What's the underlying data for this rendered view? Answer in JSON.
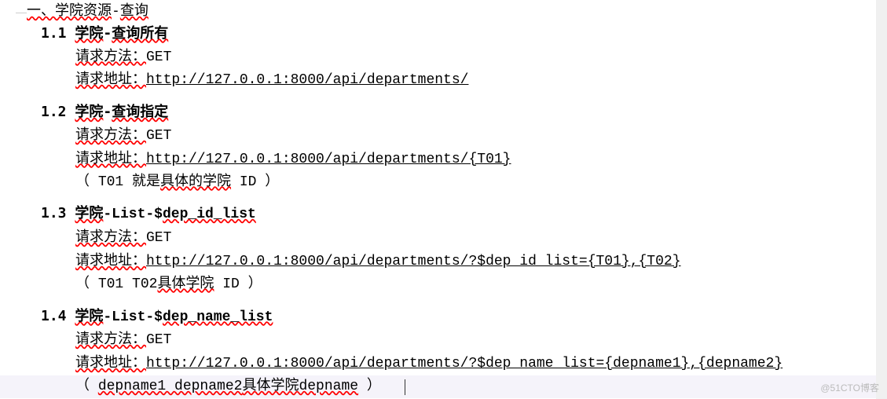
{
  "top": {
    "prefix": "一、",
    "title_wavy1": "学院资源",
    "title_dash": "-",
    "title_wavy2": "查询"
  },
  "item1": {
    "num": "1.1",
    "label_wavy": "学院",
    "label_plain": "-",
    "label_wavy2": "查询所有",
    "method_label": "请求方法：",
    "method_val": "GET",
    "url_label": "请求地址：",
    "url_val": "http://127.0.0.1:8000/api/departments/"
  },
  "item2": {
    "num": "1.2",
    "label_wavy": "学院",
    "label_plain": "-",
    "label_wavy2": "查询指定",
    "method_label": "请求方法：",
    "method_val": "GET",
    "url_label": "请求地址：",
    "url_val": "http://127.0.0.1:8000/api/departments/{T01}",
    "note_open": "（ ",
    "note_t01": "T01",
    "note_mid": " 就是",
    "note_wavy": "具体的学院",
    "note_id": " ID ",
    "note_close": "）"
  },
  "item3": {
    "num": "1.3",
    "label_wavy": "学院",
    "label_plain": "-List-$",
    "label_wavy2": "dep_id_list",
    "method_label": "请求方法：",
    "method_val": "GET",
    "url_label": "请求地址：",
    "url_val": "http://127.0.0.1:8000/api/departments/?$dep_id_list={T01},{T02}",
    "note_open": "（ ",
    "note_t01": "T01 T02",
    "note_wavy": " 具体学院",
    "note_id": " ID ",
    "note_close": "）"
  },
  "item4": {
    "num": "1.4",
    "label_wavy": "学院",
    "label_plain": "-List-$",
    "label_wavy2": "dep_name_list",
    "method_label": "请求方法：",
    "method_val": "GET",
    "url_label": "请求地址：",
    "url_val": "http://127.0.0.1:8000/api/departments/?$dep_name_list={depname1},{depname2}",
    "note_open": "（ ",
    "note_dep1": "depname1 depname2",
    "note_wavy": " 具体学院 ",
    "note_dep": "depname",
    "note_close": " ）"
  },
  "watermark": "@51CTO博客"
}
